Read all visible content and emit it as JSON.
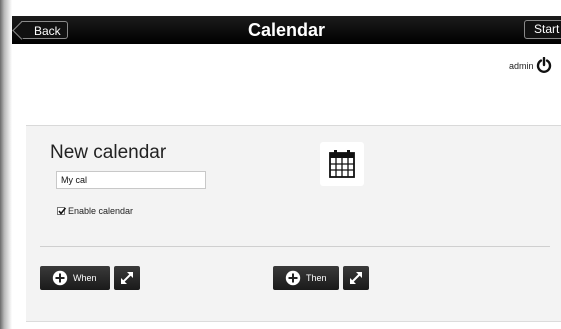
{
  "header": {
    "title": "Calendar",
    "back_label": "Back",
    "start_label": "Start"
  },
  "user": {
    "name": "admin",
    "power_icon": "power-icon"
  },
  "card": {
    "title": "New calendar",
    "name_input_value": "My cal",
    "enable_label": "Enable calendar",
    "enable_checked": true,
    "calendar_icon": "calendar-icon"
  },
  "actions": {
    "when_label": "When",
    "then_label": "Then",
    "add_icon": "plus-circle-icon",
    "expand_icon": "expand-arrows-icon"
  },
  "colors": {
    "header_bg": "#000000",
    "card_bg": "#f3f3f3",
    "button_bg": "#222222"
  }
}
